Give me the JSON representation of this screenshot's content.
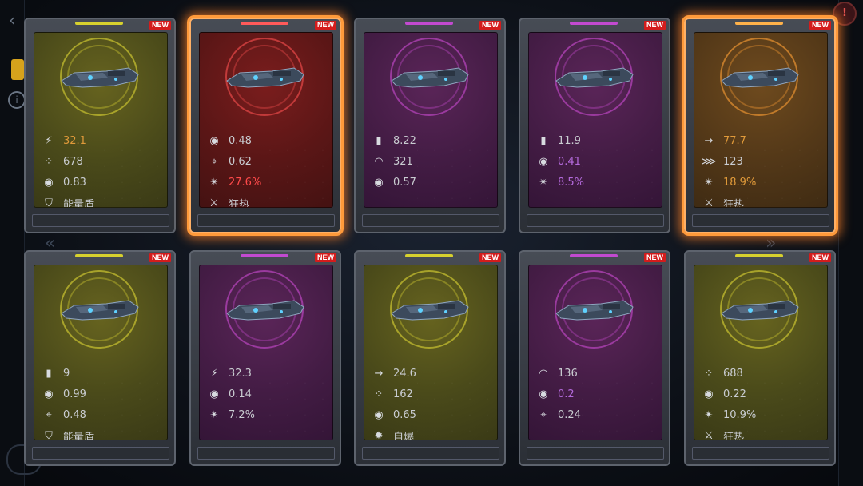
{
  "colors": {
    "yellow_accent": "#d7d12e",
    "red_accent": "#ff5a5a",
    "purple_accent": "#c24ad0",
    "orange_accent": "#ffb24a",
    "value_orange": "#e09a3a",
    "value_red": "#ff4a4a",
    "value_purple": "#b46adc",
    "value_default": "#c9ccd1"
  },
  "cards": [
    {
      "theme": "yellow",
      "new": "NEW",
      "selected": false,
      "stats": [
        {
          "icon": "fire-rate-icon",
          "glyph": "⚡",
          "value": "32.1",
          "color": "#e09a3a"
        },
        {
          "icon": "cluster-icon",
          "glyph": "⁘",
          "value": "678",
          "color": "#c9ccd1"
        },
        {
          "icon": "gear-ring-icon",
          "glyph": "◉",
          "value": "0.83",
          "color": "#c9ccd1"
        },
        {
          "icon": "shield-icon",
          "glyph": "⛉",
          "value": "能量盾",
          "color": "#c9ccd1"
        }
      ]
    },
    {
      "theme": "red",
      "new": "NEW",
      "selected": true,
      "stats": [
        {
          "icon": "gear-ring-icon",
          "glyph": "◉",
          "value": "0.48",
          "color": "#c9ccd1"
        },
        {
          "icon": "crosshair-icon",
          "glyph": "⌖",
          "value": "0.62",
          "color": "#c9ccd1"
        },
        {
          "icon": "crit-icon",
          "glyph": "✴",
          "value": "27.6%",
          "color": "#ff4a4a"
        },
        {
          "icon": "frenzy-icon",
          "glyph": "⚔",
          "value": "狂热",
          "color": "#c9ccd1"
        }
      ]
    },
    {
      "theme": "purple",
      "new": "NEW",
      "selected": false,
      "stats": [
        {
          "icon": "ammo-icon",
          "glyph": "▮",
          "value": "8.22",
          "color": "#c9ccd1"
        },
        {
          "icon": "range-arc-icon",
          "glyph": "◠",
          "value": "321",
          "color": "#c9ccd1"
        },
        {
          "icon": "gear-ring-icon",
          "glyph": "◉",
          "value": "0.57",
          "color": "#c9ccd1"
        }
      ]
    },
    {
      "theme": "purple",
      "new": "NEW",
      "selected": false,
      "stats": [
        {
          "icon": "ammo-icon",
          "glyph": "▮",
          "value": "11.9",
          "color": "#c9ccd1"
        },
        {
          "icon": "gear-ring-icon",
          "glyph": "◉",
          "value": "0.41",
          "color": "#b46adc"
        },
        {
          "icon": "crit-icon",
          "glyph": "✴",
          "value": "8.5%",
          "color": "#b46adc"
        }
      ]
    },
    {
      "theme": "orange",
      "new": "NEW",
      "selected": true,
      "stats": [
        {
          "icon": "arrow-right-icon",
          "glyph": "→",
          "value": "77.7",
          "color": "#e09a3a"
        },
        {
          "icon": "spread-icon",
          "glyph": "⋙",
          "value": "123",
          "color": "#c9ccd1"
        },
        {
          "icon": "crit-icon",
          "glyph": "✴",
          "value": "18.9%",
          "color": "#e09a3a"
        },
        {
          "icon": "frenzy-icon",
          "glyph": "⚔",
          "value": "狂热",
          "color": "#c9ccd1"
        }
      ]
    },
    {
      "theme": "yellow",
      "new": "NEW",
      "selected": false,
      "stats": [
        {
          "icon": "ammo-icon",
          "glyph": "▮",
          "value": "9",
          "color": "#c9ccd1"
        },
        {
          "icon": "gear-ring-icon",
          "glyph": "◉",
          "value": "0.99",
          "color": "#c9ccd1"
        },
        {
          "icon": "crosshair-icon",
          "glyph": "⌖",
          "value": "0.48",
          "color": "#c9ccd1"
        },
        {
          "icon": "shield-icon",
          "glyph": "⛉",
          "value": "能量盾",
          "color": "#c9ccd1"
        }
      ]
    },
    {
      "theme": "purple",
      "new": "NEW",
      "selected": false,
      "stats": [
        {
          "icon": "fire-rate-icon",
          "glyph": "⚡",
          "value": "32.3",
          "color": "#c9ccd1"
        },
        {
          "icon": "gear-ring-icon",
          "glyph": "◉",
          "value": "0.14",
          "color": "#c9ccd1"
        },
        {
          "icon": "crit-icon",
          "glyph": "✴",
          "value": "7.2%",
          "color": "#c9ccd1"
        }
      ]
    },
    {
      "theme": "yellow",
      "new": "NEW",
      "selected": false,
      "stats": [
        {
          "icon": "arrow-right-icon",
          "glyph": "→",
          "value": "24.6",
          "color": "#c9ccd1"
        },
        {
          "icon": "cluster-icon",
          "glyph": "⁘",
          "value": "162",
          "color": "#c9ccd1"
        },
        {
          "icon": "gear-ring-icon",
          "glyph": "◉",
          "value": "0.65",
          "color": "#c9ccd1"
        },
        {
          "icon": "self-destruct-icon",
          "glyph": "✹",
          "value": "自爆",
          "color": "#c9ccd1"
        }
      ]
    },
    {
      "theme": "purple",
      "new": "NEW",
      "selected": false,
      "stats": [
        {
          "icon": "range-arc-icon",
          "glyph": "◠",
          "value": "136",
          "color": "#c9ccd1"
        },
        {
          "icon": "gear-ring-icon",
          "glyph": "◉",
          "value": "0.2",
          "color": "#b46adc"
        },
        {
          "icon": "crosshair-icon",
          "glyph": "⌖",
          "value": "0.24",
          "color": "#c9ccd1"
        }
      ]
    },
    {
      "theme": "yellow",
      "new": "NEW",
      "selected": false,
      "stats": [
        {
          "icon": "cluster-icon",
          "glyph": "⁘",
          "value": "688",
          "color": "#c9ccd1"
        },
        {
          "icon": "gear-ring-icon",
          "glyph": "◉",
          "value": "0.22",
          "color": "#c9ccd1"
        },
        {
          "icon": "crit-icon",
          "glyph": "✴",
          "value": "10.9%",
          "color": "#c9ccd1"
        },
        {
          "icon": "frenzy-icon",
          "glyph": "⚔",
          "value": "狂热",
          "color": "#c9ccd1"
        }
      ]
    }
  ]
}
